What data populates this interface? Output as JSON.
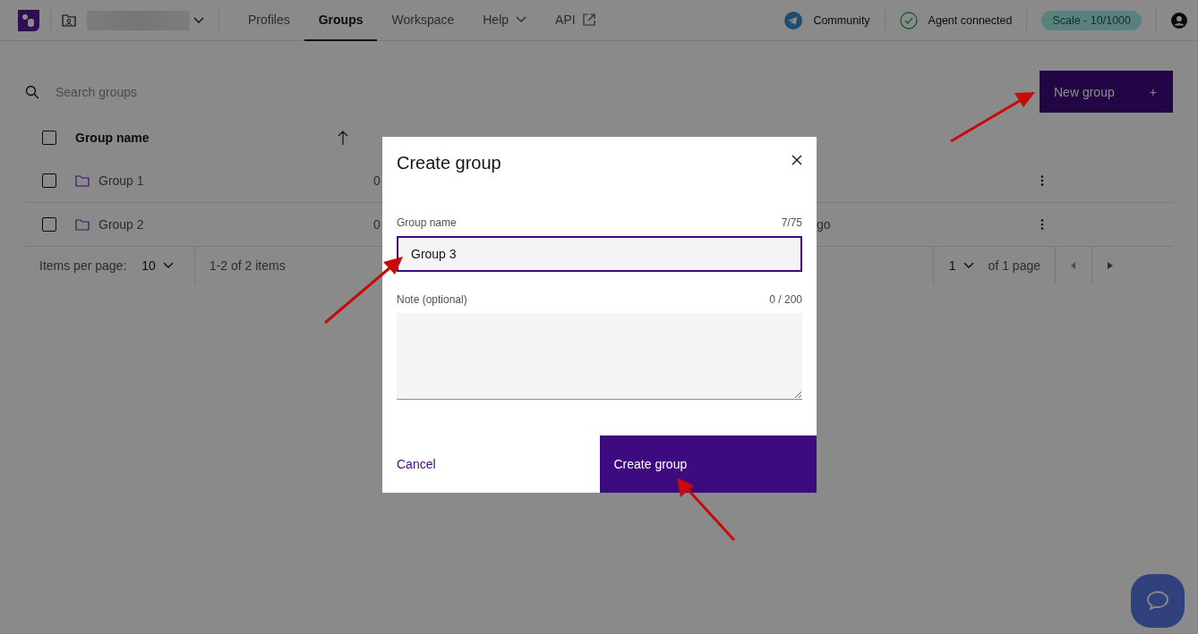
{
  "header": {
    "nav": [
      {
        "label": "Profiles",
        "selected": false,
        "kind": "plain"
      },
      {
        "label": "Groups",
        "selected": true,
        "kind": "plain"
      },
      {
        "label": "Workspace",
        "selected": false,
        "kind": "plain"
      },
      {
        "label": "Help",
        "selected": false,
        "kind": "dropdown"
      },
      {
        "label": "API",
        "selected": false,
        "kind": "external"
      }
    ],
    "community": "Community",
    "agent_status": "Agent connected",
    "plan_badge": "Scale - 10/1000"
  },
  "search": {
    "placeholder": "Search groups"
  },
  "new_group_button": {
    "label": "New group",
    "icon": "+"
  },
  "table": {
    "select_all_checked": false,
    "columns": [
      "Group name"
    ],
    "rows": [
      {
        "name": "Group 1",
        "profiles": "0",
        "checked": false
      },
      {
        "name": "Group 2",
        "profiles": "0",
        "created": "go",
        "checked": false
      }
    ]
  },
  "pagination": {
    "items_per_page_label": "Items per page:",
    "items_per_page": "10",
    "range": "1-2 of 2 items",
    "page": "1",
    "page_total": "of 1 page"
  },
  "dialog": {
    "title": "Create group",
    "fields": [
      {
        "kind": "input",
        "label": "Group name",
        "counter": "7/75",
        "value": "Group 3"
      },
      {
        "kind": "textarea",
        "label": "Note (optional)",
        "counter": "0 / 200"
      }
    ],
    "cancel": "Cancel",
    "submit": "Create group"
  }
}
